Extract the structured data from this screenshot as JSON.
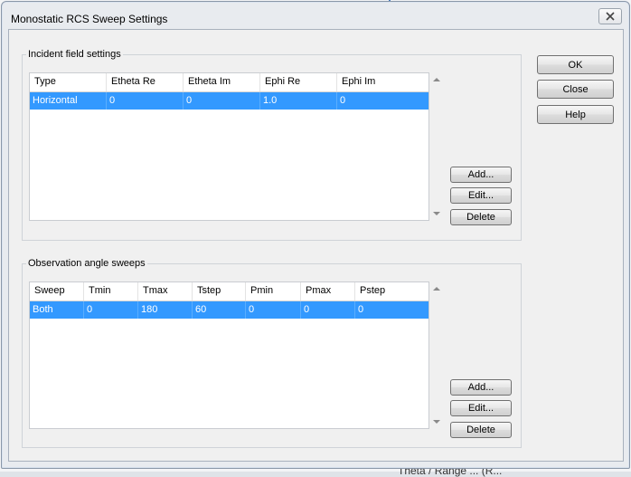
{
  "window": {
    "title": "Monostatic RCS Sweep Settings"
  },
  "buttons": {
    "ok": "OK",
    "close": "Close",
    "help": "Help"
  },
  "incident": {
    "title": "Incident field settings",
    "columns": [
      "Type",
      "Etheta Re",
      "Etheta Im",
      "Ephi Re",
      "Ephi Im"
    ],
    "rows": [
      [
        "Horizontal",
        "0",
        "0",
        "1.0",
        "0"
      ]
    ],
    "add": "Add...",
    "edit": "Edit...",
    "delete": "Delete"
  },
  "observation": {
    "title": "Observation angle sweeps",
    "columns": [
      "Sweep",
      "Tmin",
      "Tmax",
      "Tstep",
      "Pmin",
      "Pmax",
      "Pstep"
    ],
    "rows": [
      [
        "Both",
        "0",
        "180",
        "60",
        "0",
        "0",
        "0"
      ]
    ],
    "add": "Add...",
    "edit": "Edit...",
    "delete": "Delete"
  },
  "background_text": "Theta / Range ... (R..."
}
